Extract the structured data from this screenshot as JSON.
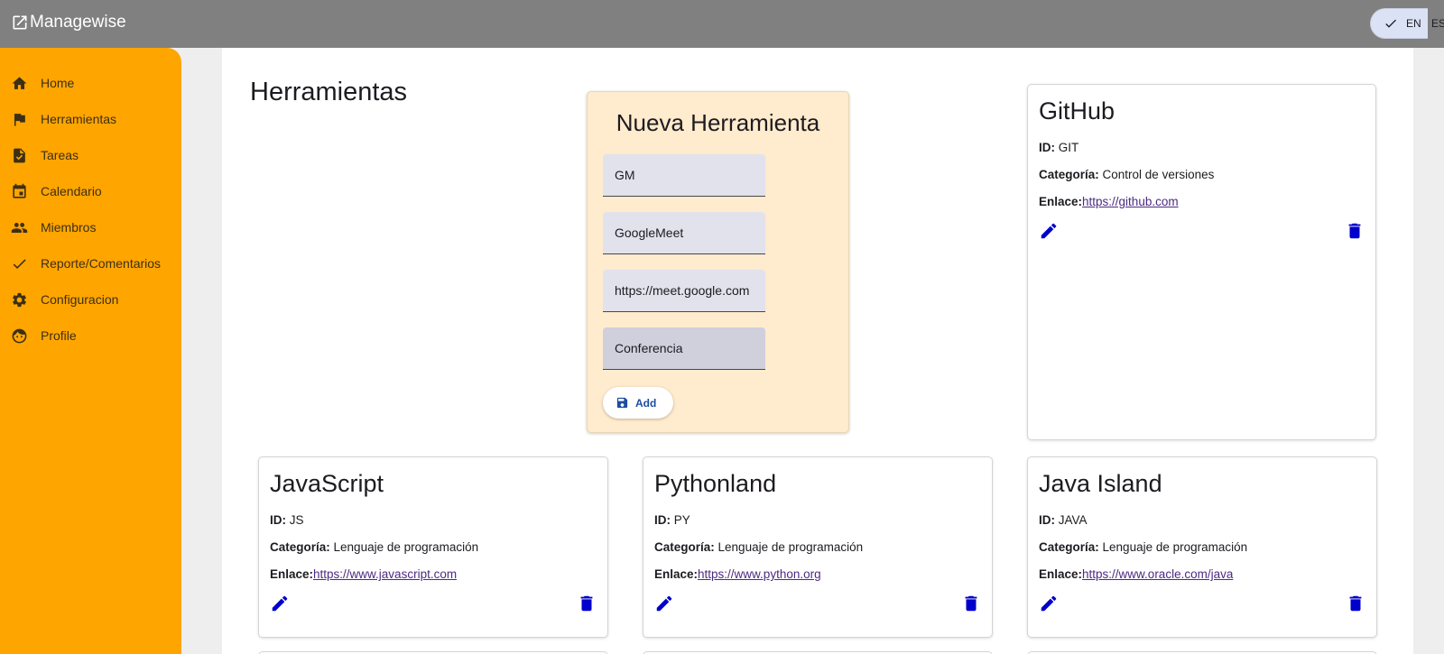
{
  "app": {
    "name": "Managewise",
    "languages": {
      "selected": "EN",
      "other": "ES"
    }
  },
  "sidebar": {
    "items": [
      {
        "label": "Home",
        "icon": "home-icon"
      },
      {
        "label": "Herramientas",
        "icon": "flag-icon"
      },
      {
        "label": "Tareas",
        "icon": "task-icon"
      },
      {
        "label": "Calendario",
        "icon": "calendar-icon"
      },
      {
        "label": "Miembros",
        "icon": "people-icon"
      },
      {
        "label": "Reporte/Comentarios",
        "icon": "check-icon"
      },
      {
        "label": "Configuracion",
        "icon": "gear-icon"
      },
      {
        "label": "Profile",
        "icon": "face-icon"
      }
    ]
  },
  "page": {
    "title": "Herramientas"
  },
  "new_tool": {
    "title": "Nueva Herramienta",
    "fields": {
      "id": "GM",
      "name": "GoogleMeet",
      "url": "https://meet.google.com",
      "category": "Conferencia"
    },
    "add_label": "Add"
  },
  "labels": {
    "id": "ID:",
    "category": "Categoría:",
    "link": "Enlace:"
  },
  "tools": [
    {
      "name": "GitHub",
      "id": "GIT",
      "category": "Control de versiones",
      "link": "https://github.com"
    },
    {
      "name": "JavaScript",
      "id": "JS",
      "category": "Lenguaje de programación",
      "link": "https://www.javascript.com"
    },
    {
      "name": "Pythonland",
      "id": "PY",
      "category": "Lenguaje de programación",
      "link": "https://www.python.org"
    },
    {
      "name": "Java Island",
      "id": "JAVA",
      "category": "Lenguaje de programación",
      "link": "https://www.oracle.com/java"
    }
  ],
  "colors": {
    "topbar": "#808080",
    "sidebar": "#ffa500",
    "new_card": "#ffebcd",
    "action_icons": "#0000cc",
    "link": "#4b2a82"
  }
}
